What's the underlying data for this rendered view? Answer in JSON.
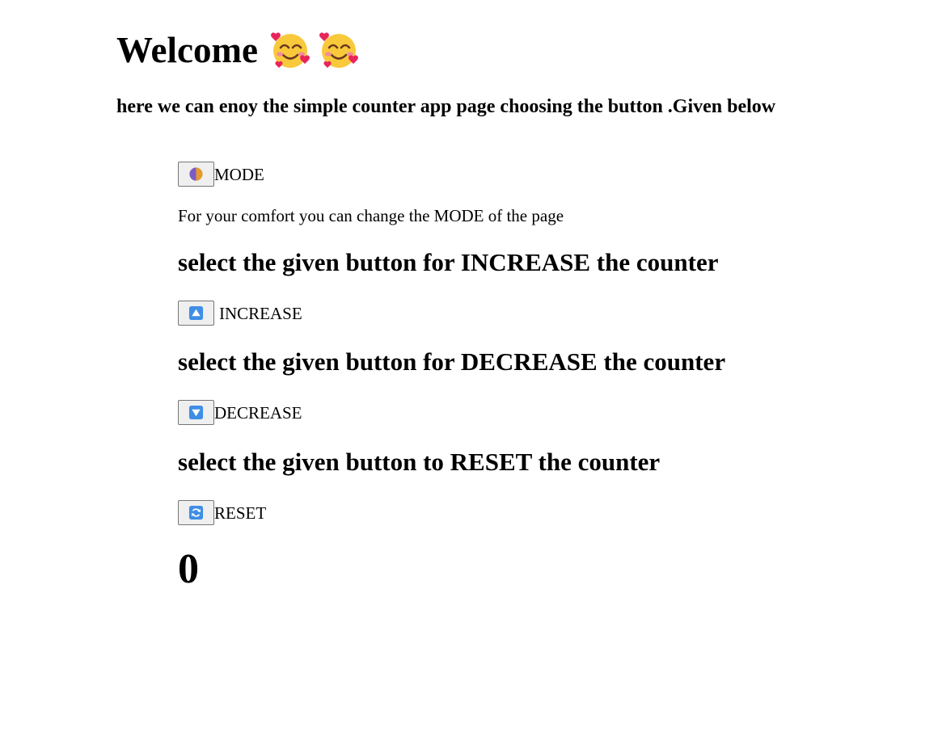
{
  "header": {
    "title": "Welcome",
    "title_emojis": [
      "smiling-face-with-hearts-icon",
      "smiling-face-with-hearts-icon"
    ],
    "intro": "here we can enoy the simple counter app page choosing the button .Given below"
  },
  "mode": {
    "icon": "half-moon-mode-icon",
    "label": "MODE",
    "note": "For your comfort you can change the MODE of the page"
  },
  "increase": {
    "heading": "select the given button for INCREASE the counter",
    "icon": "up-arrow-icon",
    "label": "INCREASE"
  },
  "decrease": {
    "heading": "select the given button for DECREASE the counter",
    "icon": "down-arrow-icon",
    "label": "DECREASE"
  },
  "reset": {
    "heading": "select the given button to RESET the counter",
    "icon": "refresh-icon",
    "label": "RESET"
  },
  "counter": {
    "value": "0"
  },
  "colors": {
    "button_bg": "#efefef",
    "button_border": "#767676",
    "arrow_icon_blue": "#3f8ee6",
    "mode_icon_purple": "#7b5cc4",
    "mode_icon_orange": "#e59a2f"
  }
}
